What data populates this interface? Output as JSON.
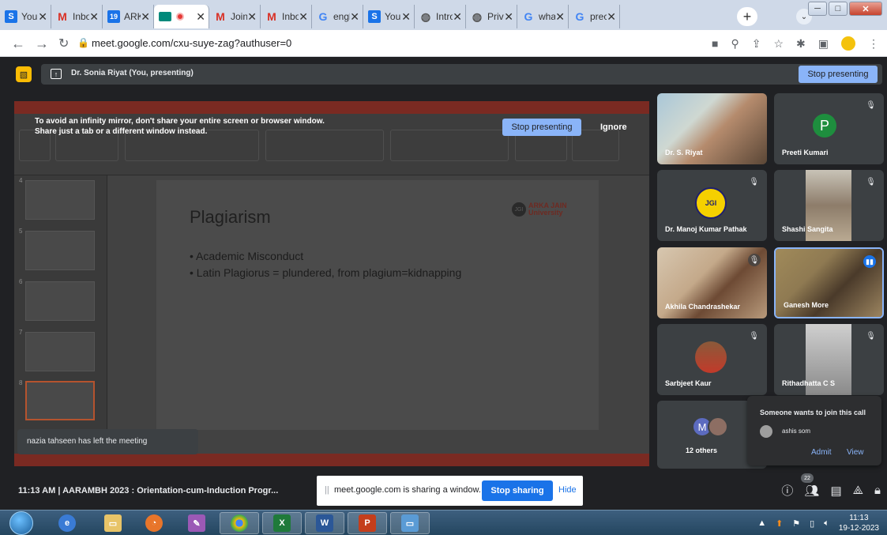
{
  "browser": {
    "tabs": [
      {
        "icon": "s-icon",
        "title": "You"
      },
      {
        "icon": "gmail-icon",
        "title": "Inbo"
      },
      {
        "icon": "calendar-icon",
        "title": "ARK"
      },
      {
        "icon": "meet-icon",
        "title": ""
      },
      {
        "icon": "gmail-icon",
        "title": "Join"
      },
      {
        "icon": "gmail-icon",
        "title": "Inbo"
      },
      {
        "icon": "google-icon",
        "title": "engl"
      },
      {
        "icon": "s-icon",
        "title": "You"
      },
      {
        "icon": "globe-icon",
        "title": "Intro"
      },
      {
        "icon": "globe-icon",
        "title": "Priva"
      },
      {
        "icon": "google-icon",
        "title": "wha"
      },
      {
        "icon": "google-icon",
        "title": "prec"
      }
    ],
    "url": "meet.google.com/cxu-suye-zag?authuser=0"
  },
  "meet": {
    "presenting_label": "Dr. Sonia Riyat (You, presenting)",
    "stop_presenting": "Stop presenting",
    "warning_text": "To avoid an infinity mirror, don't share your entire screen or browser window. Share just a tab or a different window instead.",
    "warning_stop": "Stop presenting",
    "warning_ignore": "Ignore",
    "toast": "nazia tahseen has left the meeting",
    "participants": [
      {
        "name": "Dr. S. Riyat"
      },
      {
        "name": "Preeti Kumari",
        "initial": "P"
      },
      {
        "name": "Dr. Manoj Kumar Pathak"
      },
      {
        "name": "Shashi Sangita"
      },
      {
        "name": "Akhila Chandrashekar"
      },
      {
        "name": "Ganesh More"
      },
      {
        "name": "Sarbjeet Kaur"
      },
      {
        "name": "Rithadhatta C S"
      }
    ],
    "others": {
      "label": "12 others",
      "initial": "M"
    },
    "join_request": {
      "title": "Someone wants to join this call",
      "name": "ashis som",
      "admit": "Admit",
      "view": "View"
    },
    "meeting_info": "11:13 AM  |  AARAMBH 2023 : Orientation-cum-Induction Progr...",
    "share_text": "meet.google.com is sharing a window.",
    "stop_sharing": "Stop sharing",
    "hide": "Hide",
    "participant_count": "22"
  },
  "slide": {
    "title": "Plagiarism",
    "bullets": [
      "Academic Misconduct",
      "Latin Plagiorus = plundered, from plagium=kidnapping"
    ],
    "logo_line1": "ARKA JAIN",
    "logo_line2": "University",
    "logo_badge": "JGI"
  },
  "taskbar": {
    "time": "11:13",
    "date": "19-12-2023"
  }
}
